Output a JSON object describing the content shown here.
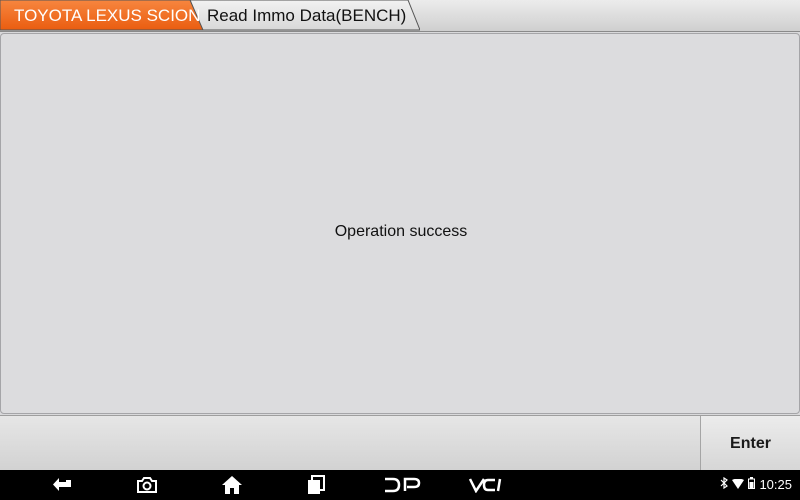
{
  "breadcrumb": {
    "items": [
      {
        "label": "TOYOTA LEXUS SCION",
        "active": true
      },
      {
        "label": "Read Immo Data(BENCH)",
        "active": false
      }
    ]
  },
  "main": {
    "message": "Operation success"
  },
  "footer": {
    "enter_label": "Enter"
  },
  "navbar": {
    "icons": [
      "back-icon",
      "camera-icon",
      "home-icon",
      "recent-apps-icon",
      "dp-icon",
      "vci-icon"
    ],
    "dp_label": "DP",
    "vci_label": "VCI"
  },
  "status_bar": {
    "icons": [
      "bluetooth-icon",
      "wifi-icon",
      "battery-icon"
    ],
    "time": "10:25"
  },
  "colors": {
    "active_tab": "#f06a1c",
    "inactive_tab": "#e2e2e2",
    "background": "#dcdcde",
    "navbar": "#000000"
  }
}
